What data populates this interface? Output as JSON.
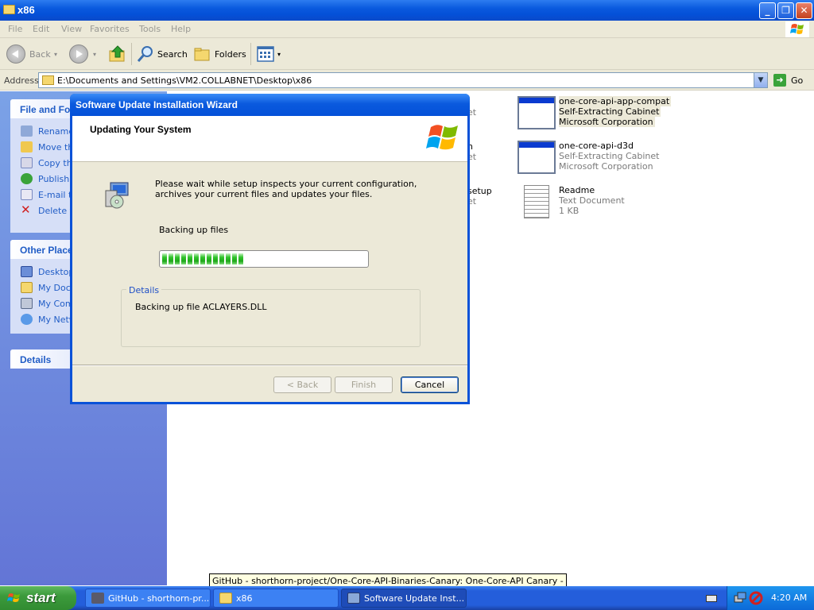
{
  "explorer": {
    "title": "x86",
    "menu": [
      "File",
      "Edit",
      "View",
      "Favorites",
      "Tools",
      "Help"
    ],
    "toolbar": {
      "back": "Back",
      "search": "Search",
      "folders": "Folders"
    },
    "address": {
      "label": "Address",
      "value": "E:\\Documents and Settings\\VM2.COLLABNET\\Desktop\\x86",
      "go": "Go"
    },
    "panes": {
      "file_folder_title": "File and Fol",
      "file_folder_items": [
        "Rename",
        "Move th",
        "Copy th",
        "Publish t",
        "E-mail th",
        "Delete th"
      ],
      "other_places_title": "Other Place",
      "other_places_items": [
        "Desktop",
        "My Docu",
        "My Comp",
        "My Netw"
      ],
      "details_title": "Details"
    },
    "files": [
      {
        "name": "one-core-api-app-compat",
        "line1": "Self-Extracting Cabinet",
        "line2": "Microsoft Corporation"
      },
      {
        "name": "one-core-api-d3d",
        "line1": "Self-Extracting Cabinet",
        "line2": "Microsoft Corporation"
      },
      {
        "name": "Readme",
        "line1": "Text Document",
        "line2": "1 KB"
      }
    ],
    "partial_texts": [
      "et",
      "n",
      "et",
      "setup",
      "et"
    ]
  },
  "dialog": {
    "title": "Software Update Installation Wizard",
    "header": "Updating Your System",
    "message": "Please wait while setup inspects your current configuration, archives your current files and updates your files.",
    "status": "Backing up files",
    "progress_fraction": 0.4,
    "progress_segments_total": 32,
    "details_legend": "Details",
    "details_text": "Backing up file ACLAYERS.DLL",
    "buttons": {
      "back": "< Back",
      "finish": "Finish",
      "cancel": "Cancel"
    }
  },
  "tooltip": "GitHub - shorthorn-project/One-Core-API-Binaries-Canary: One-Core-API Canary -",
  "taskbar": {
    "start": "start",
    "tasks": [
      {
        "label": "GitHub - shorthorn-pr...",
        "active": false
      },
      {
        "label": "x86",
        "active": false
      },
      {
        "label": "Software Update Inst...",
        "active": true
      }
    ],
    "clock": "4:20 AM"
  },
  "colors": {
    "xp_blue": "#0a5ade",
    "link_blue": "#215dc6",
    "progress_green": "#31c42c",
    "start_green": "#3c9a3c"
  }
}
